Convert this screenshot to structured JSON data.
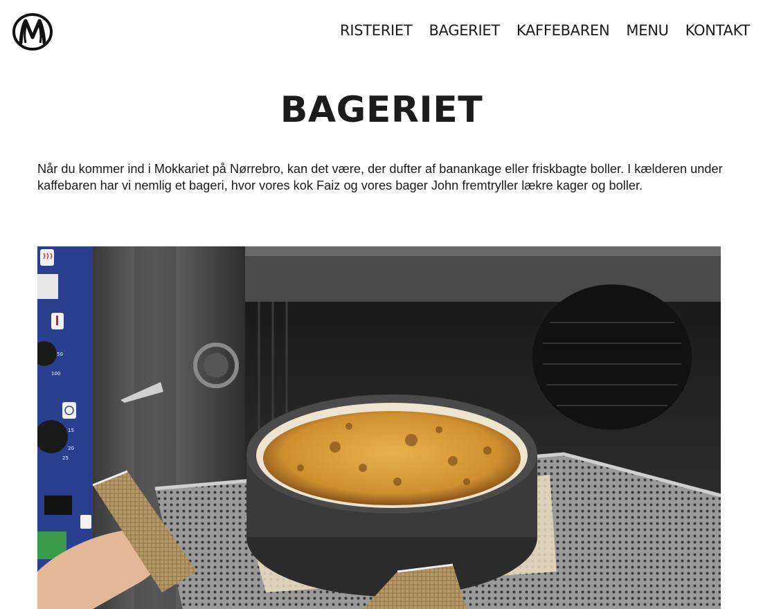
{
  "header": {
    "logo_letter": "M",
    "nav": [
      {
        "label": "RISTERIET"
      },
      {
        "label": "BAGERIET"
      },
      {
        "label": "KAFFEBAREN"
      },
      {
        "label": "MENU"
      },
      {
        "label": "KONTAKT"
      }
    ]
  },
  "main": {
    "title": "BAGERIET",
    "intro": "Når du kommer ind i Mokkariet på Nørrebro, kan det være, der dufter af banankage eller friskbagte boller. I kælderen under kaffebaren har vi nemlig et bageri, hvor vores kok Faiz og vores bager John fremtryller lækre kager og boller."
  },
  "photo": {
    "oven_dial_marks": [
      "50",
      "100",
      "15",
      "20",
      "25"
    ]
  },
  "colors": {
    "text": "#1c1c1c",
    "background": "#ffffff",
    "oven_panel_blue": "#2b3f8f",
    "cake_top": "#d99a3a"
  }
}
